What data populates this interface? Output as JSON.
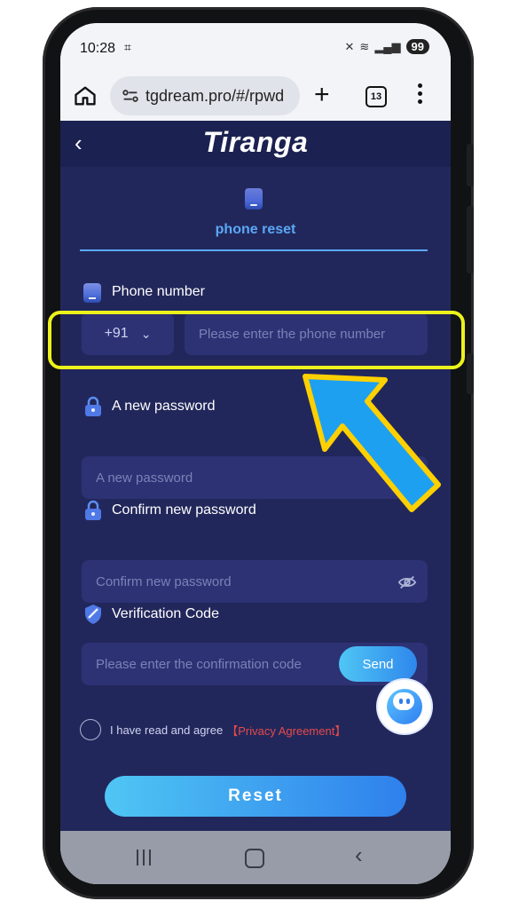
{
  "status_bar": {
    "time": "10:28",
    "battery": "99"
  },
  "browser": {
    "url": "tgdream.pro/#/rpwd",
    "tab_count": "13"
  },
  "app": {
    "brand": "Tiranga",
    "tab_label": "phone reset",
    "phone": {
      "label": "Phone number",
      "country_code": "+91",
      "placeholder": "Please enter the phone number"
    },
    "new_password": {
      "label": "A new password",
      "placeholder": "A new password"
    },
    "confirm_password": {
      "label": "Confirm new password",
      "placeholder": "Confirm new password"
    },
    "verification": {
      "label": "Verification Code",
      "placeholder": "Please enter the confirmation code",
      "send_label": "Send"
    },
    "agreement": {
      "text": "I have read and agree",
      "link": "【Privacy Agreement】"
    },
    "reset_label": "Reset"
  },
  "colors": {
    "app_background": "#22275b",
    "accent": "#4fc6f4",
    "link": "#e44a4a",
    "highlight": "#ecf21c",
    "arrow": "#1ea0f0"
  }
}
